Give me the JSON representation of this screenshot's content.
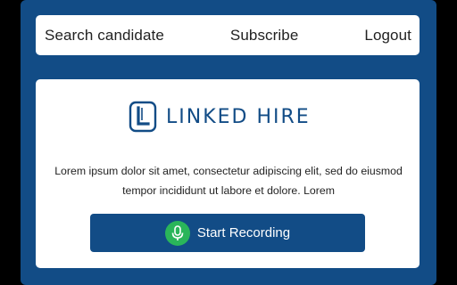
{
  "nav": {
    "search_label": "Search candidate",
    "subscribe_label": "Subscribe",
    "logout_label": "Logout"
  },
  "brand": {
    "logo_text": "LINKED HIRE",
    "logo_icon": "L-logo-icon"
  },
  "main": {
    "description": "Lorem ipsum dolor sit amet, consectetur adipiscing elit, sed do eiusmod tempor incididunt ut labore et dolore. Lorem",
    "record_button_label": "Start Recording",
    "record_icon": "microphone-icon"
  },
  "colors": {
    "brand_blue": "#124c86",
    "mic_green": "#2ab55a",
    "background_white": "#ffffff"
  }
}
